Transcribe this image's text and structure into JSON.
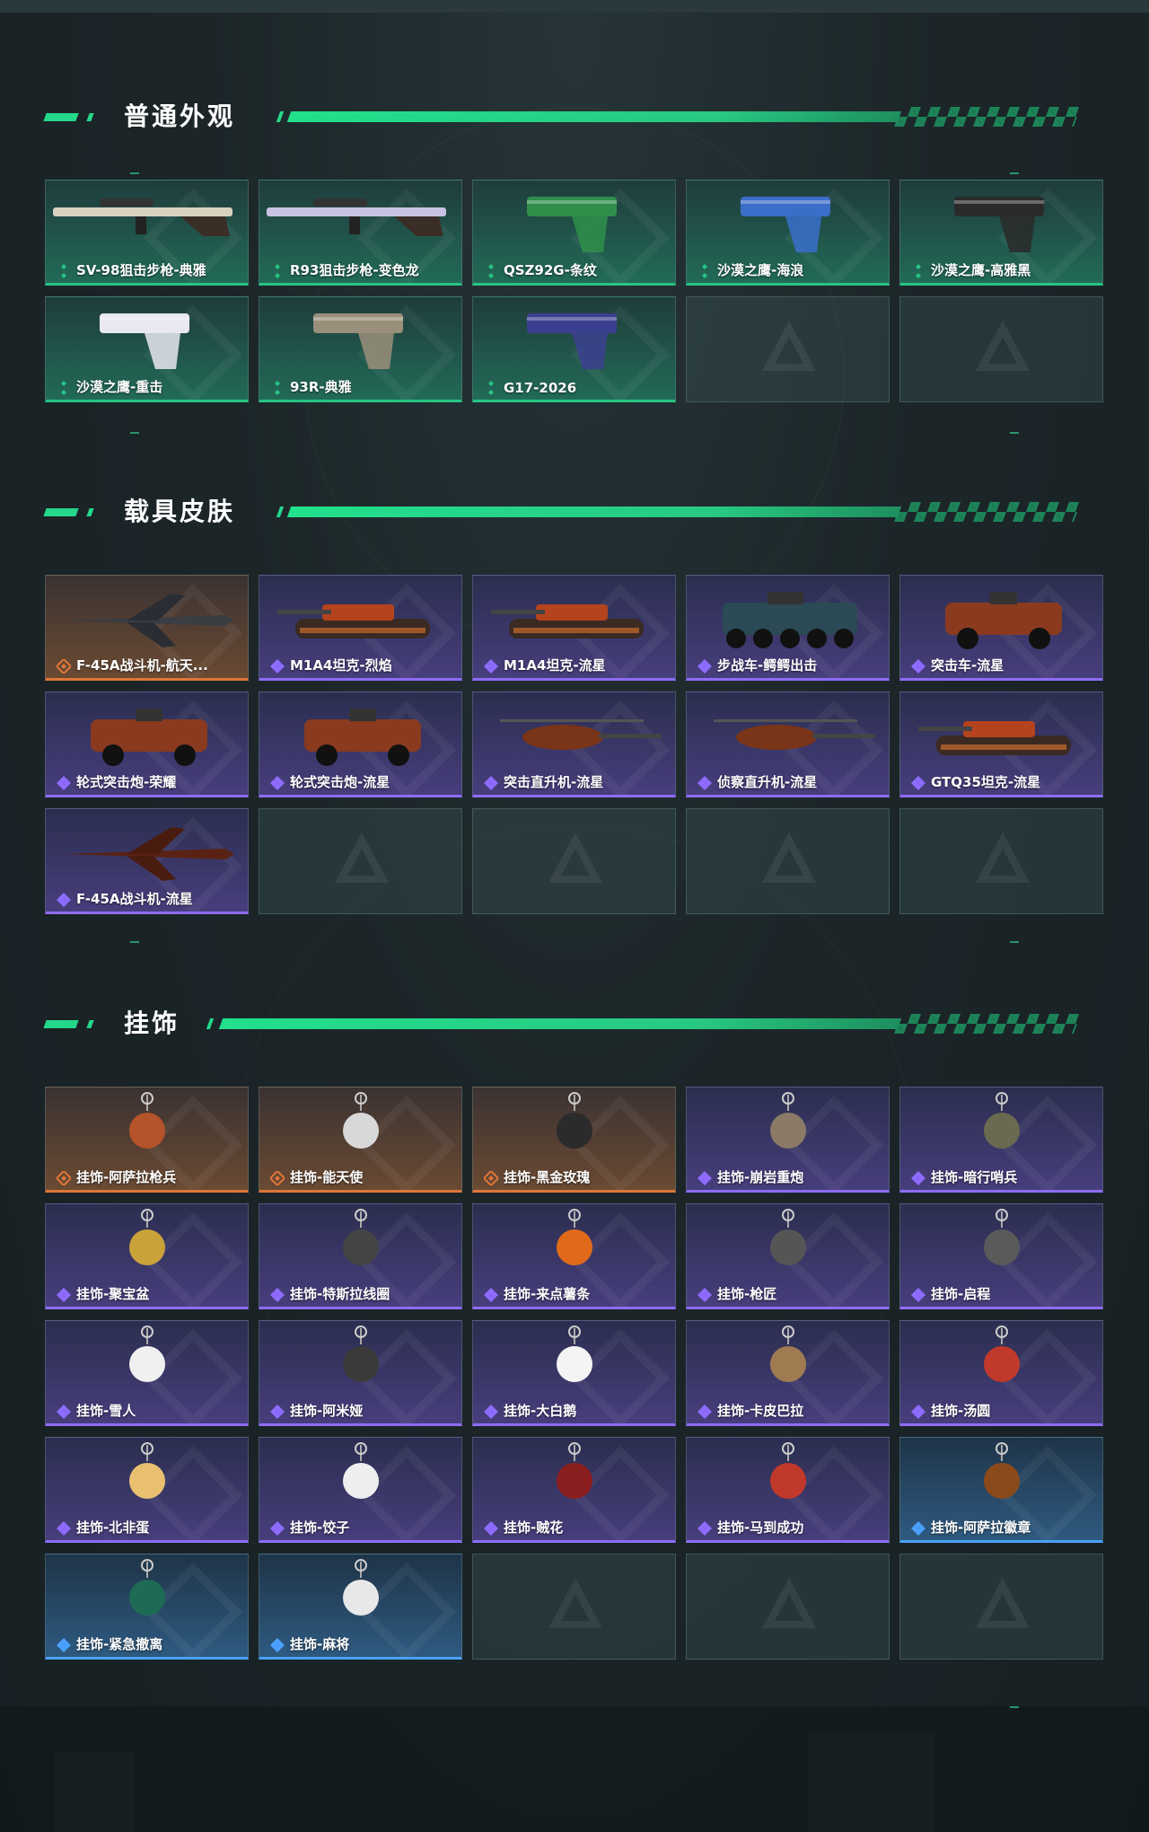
{
  "colors": {
    "accent_green": "#25d88a",
    "rarity_green": "#26c483",
    "rarity_purple": "#8e6cff",
    "rarity_orange": "#e0763a",
    "rarity_blue": "#4aa1ff"
  },
  "sections": [
    {
      "title": "普通外观",
      "items": [
        {
          "label": "SV-98狙击步枪-典雅",
          "rarity": "green",
          "icon": "sniper-rifle-icon"
        },
        {
          "label": "R93狙击步枪-变色龙",
          "rarity": "green",
          "icon": "sniper-rifle-icon"
        },
        {
          "label": "QSZ92G-条纹",
          "rarity": "green",
          "icon": "pistol-icon"
        },
        {
          "label": "沙漠之鹰-海浪",
          "rarity": "green",
          "icon": "pistol-icon"
        },
        {
          "label": "沙漠之鹰-高雅黑",
          "rarity": "green",
          "icon": "pistol-icon"
        },
        {
          "label": "沙漠之鹰-重击",
          "rarity": "green",
          "icon": "pistol-icon"
        },
        {
          "label": "93R-典雅",
          "rarity": "green",
          "icon": "pistol-icon"
        },
        {
          "label": "G17-2026",
          "rarity": "green",
          "icon": "pistol-icon"
        },
        {
          "label": "",
          "rarity": "empty",
          "icon": "empty-slot-icon"
        },
        {
          "label": "",
          "rarity": "empty",
          "icon": "empty-slot-icon"
        }
      ]
    },
    {
      "title": "载具皮肤",
      "items": [
        {
          "label": "F-45A战斗机-航天...",
          "rarity": "orange",
          "icon": "fighter-jet-icon"
        },
        {
          "label": "M1A4坦克-烈焰",
          "rarity": "purple",
          "icon": "tank-icon"
        },
        {
          "label": "M1A4坦克-流星",
          "rarity": "purple",
          "icon": "tank-icon"
        },
        {
          "label": "步战车-鳄鳄出击",
          "rarity": "purple",
          "icon": "ifv-icon"
        },
        {
          "label": "突击车-流星",
          "rarity": "purple",
          "icon": "assault-vehicle-icon"
        },
        {
          "label": "轮式突击炮-荣耀",
          "rarity": "purple",
          "icon": "assault-vehicle-icon"
        },
        {
          "label": "轮式突击炮-流星",
          "rarity": "purple",
          "icon": "assault-vehicle-icon"
        },
        {
          "label": "突击直升机-流星",
          "rarity": "purple",
          "icon": "helicopter-icon"
        },
        {
          "label": "侦察直升机-流星",
          "rarity": "purple",
          "icon": "helicopter-icon"
        },
        {
          "label": "GTQ35坦克-流星",
          "rarity": "purple",
          "icon": "tank-icon"
        },
        {
          "label": "F-45A战斗机-流星",
          "rarity": "purple",
          "icon": "fighter-jet-icon"
        },
        {
          "label": "",
          "rarity": "empty",
          "icon": "empty-slot-icon"
        },
        {
          "label": "",
          "rarity": "empty",
          "icon": "empty-slot-icon"
        },
        {
          "label": "",
          "rarity": "empty",
          "icon": "empty-slot-icon"
        },
        {
          "label": "",
          "rarity": "empty",
          "icon": "empty-slot-icon"
        }
      ]
    },
    {
      "title": "挂饰",
      "items": [
        {
          "label": "挂饰-阿萨拉枪兵",
          "rarity": "orange",
          "icon": "charm-icon"
        },
        {
          "label": "挂饰-能天使",
          "rarity": "orange",
          "icon": "charm-icon"
        },
        {
          "label": "挂饰-黑金玫瑰",
          "rarity": "orange",
          "icon": "charm-icon"
        },
        {
          "label": "挂饰-崩岩重炮",
          "rarity": "purple",
          "icon": "charm-icon"
        },
        {
          "label": "挂饰-暗行哨兵",
          "rarity": "purple",
          "icon": "charm-icon"
        },
        {
          "label": "挂饰-聚宝盆",
          "rarity": "purple",
          "icon": "charm-icon"
        },
        {
          "label": "挂饰-特斯拉线圈",
          "rarity": "purple",
          "icon": "charm-icon"
        },
        {
          "label": "挂饰-来点薯条",
          "rarity": "purple",
          "icon": "charm-icon"
        },
        {
          "label": "挂饰-枪匠",
          "rarity": "purple",
          "icon": "charm-icon"
        },
        {
          "label": "挂饰-启程",
          "rarity": "purple",
          "icon": "charm-icon"
        },
        {
          "label": "挂饰-雪人",
          "rarity": "purple",
          "icon": "charm-icon"
        },
        {
          "label": "挂饰-阿米娅",
          "rarity": "purple",
          "icon": "charm-icon"
        },
        {
          "label": "挂饰-大白鹅",
          "rarity": "purple",
          "icon": "charm-icon"
        },
        {
          "label": "挂饰-卡皮巴拉",
          "rarity": "purple",
          "icon": "charm-icon"
        },
        {
          "label": "挂饰-汤圆",
          "rarity": "purple",
          "icon": "charm-icon"
        },
        {
          "label": "挂饰-北非蛋",
          "rarity": "purple",
          "icon": "charm-icon"
        },
        {
          "label": "挂饰-饺子",
          "rarity": "purple",
          "icon": "charm-icon"
        },
        {
          "label": "挂饰-贼花",
          "rarity": "purple",
          "icon": "charm-icon"
        },
        {
          "label": "挂饰-马到成功",
          "rarity": "purple",
          "icon": "charm-icon"
        },
        {
          "label": "挂饰-阿萨拉徽章",
          "rarity": "blue",
          "icon": "charm-icon"
        },
        {
          "label": "挂饰-紧急撤离",
          "rarity": "blue",
          "icon": "charm-icon"
        },
        {
          "label": "挂饰-麻将",
          "rarity": "blue",
          "icon": "charm-icon"
        },
        {
          "label": "",
          "rarity": "empty",
          "icon": "empty-slot-icon"
        },
        {
          "label": "",
          "rarity": "empty",
          "icon": "empty-slot-icon"
        },
        {
          "label": "",
          "rarity": "empty",
          "icon": "empty-slot-icon"
        }
      ]
    }
  ]
}
